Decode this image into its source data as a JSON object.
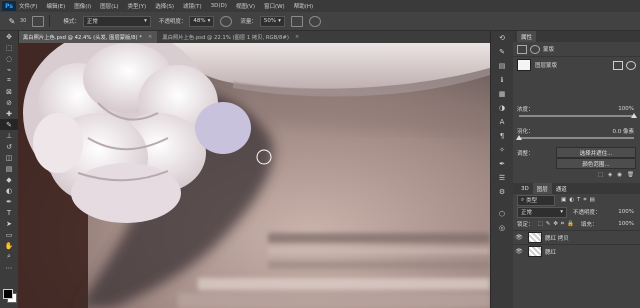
{
  "menubar": {
    "items": [
      "文件(F)",
      "编辑(E)",
      "图像(I)",
      "图层(L)",
      "类型(Y)",
      "选择(S)",
      "滤镜(T)",
      "3D(D)",
      "视图(V)",
      "窗口(W)",
      "帮助(H)"
    ]
  },
  "options": {
    "brush_size": "30",
    "mode_label": "模式：",
    "mode_value": "正常",
    "opacity_label": "不透明度：",
    "opacity_value": "48%",
    "flow_label": "流量：",
    "flow_value": "50%"
  },
  "tabs": [
    {
      "label": "黑白照片上色.psd @ 42.4% (头发, 图层蒙版/8) *",
      "active": true
    },
    {
      "label": "黑白照片上色.psd @ 22.1% (图层 1 拷贝, RGB/8#)",
      "active": false
    }
  ],
  "properties": {
    "title": "属性",
    "mask_type": "蒙版",
    "mask_name": "图层蒙版",
    "density_label": "浓度：",
    "density_value": "100%",
    "feather_label": "羽化：",
    "feather_value": "0.0 像素",
    "adjust_label": "调整：",
    "select_and_mask": "选择并遮住...",
    "color_range": "颜色范围..."
  },
  "layers_panel": {
    "tab_layers": "图层",
    "tab_channels": "通道",
    "tab_3d": "3D",
    "kind_label": "类型",
    "blend_mode": "正常",
    "opacity_label": "不透明度：",
    "opacity_value": "100%",
    "lock_label": "锁定：",
    "fill_label": "填充：",
    "fill_value": "100%",
    "layers": [
      {
        "name": "腮红 拷贝",
        "visible": true
      },
      {
        "name": "腮红",
        "visible": true
      }
    ]
  },
  "colors": {
    "accent": "#31a8ff",
    "foreground": "#000000",
    "background": "#ffffff"
  }
}
